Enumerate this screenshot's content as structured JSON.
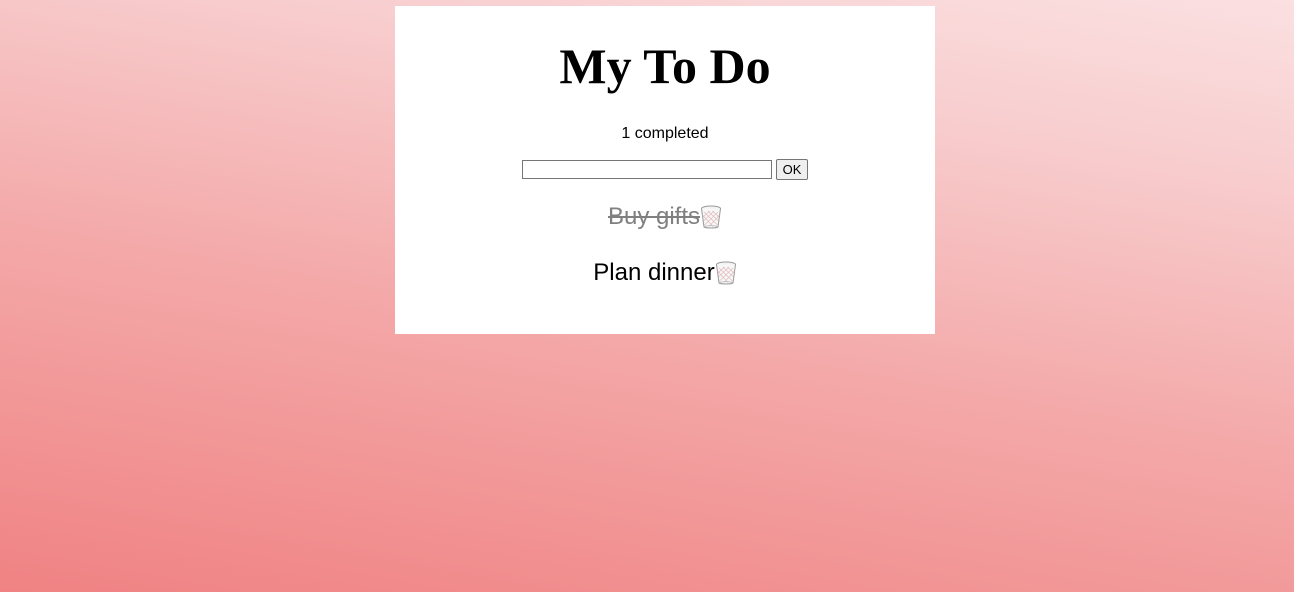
{
  "header": {
    "title": "My To Do"
  },
  "status": {
    "completed_text": "1 completed"
  },
  "form": {
    "input_value": "",
    "input_placeholder": "",
    "submit_label": "OK"
  },
  "todos": [
    {
      "text": "Buy gifts ",
      "completed": true,
      "icon": "trash-icon"
    },
    {
      "text": "Plan dinner",
      "completed": false,
      "icon": "trash-icon"
    }
  ],
  "colors": {
    "completed_text": "#808080",
    "card_background": "#ffffff",
    "background_top": "#fbe0e1",
    "background_bottom": "#f08283"
  }
}
